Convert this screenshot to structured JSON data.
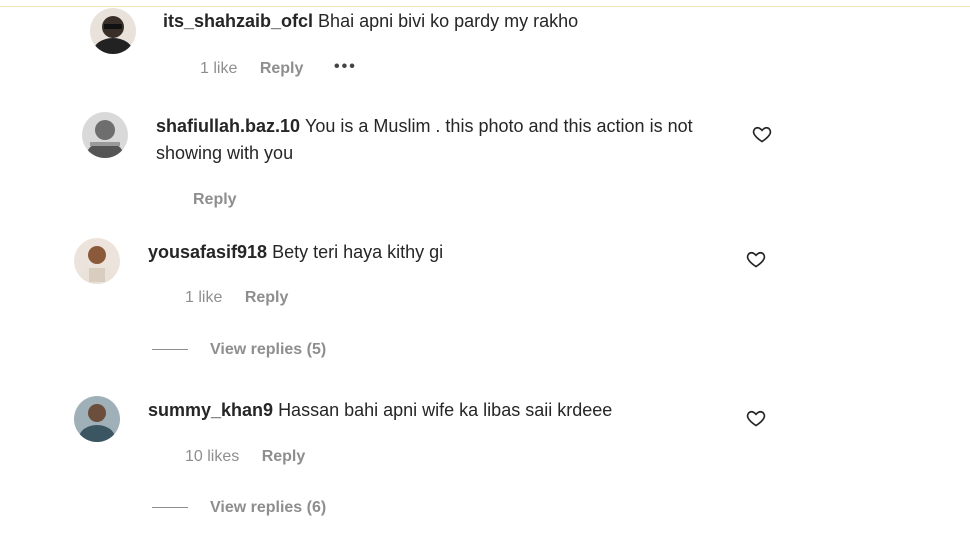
{
  "comments": [
    {
      "username": "its_shahzaib_ofcl",
      "text": "Bhai apni bivi ko pardy my rakho",
      "likes": "1 like",
      "reply": "Reply",
      "more": "•••",
      "avatar_color": "#3a3a3a"
    },
    {
      "username": "shafiullah.baz.10",
      "text": "You is a Muslim . this photo and this action is not showing with you",
      "reply": "Reply",
      "avatar_color": "#7a7a7a"
    },
    {
      "username": "yousafasif918",
      "text": "Bety teri haya kithy gi",
      "likes": "1 like",
      "reply": "Reply",
      "view_replies": "View replies (5)",
      "avatar_color": "#c9a98a"
    },
    {
      "username": "summy_khan9",
      "text": "Hassan bahi apni wife ka libas saii krdeee",
      "likes": "10 likes",
      "reply": "Reply",
      "view_replies": "View replies (6)",
      "avatar_color": "#4d6a78"
    }
  ],
  "colors": {
    "text": "#262626",
    "muted": "#8e8e8e"
  }
}
